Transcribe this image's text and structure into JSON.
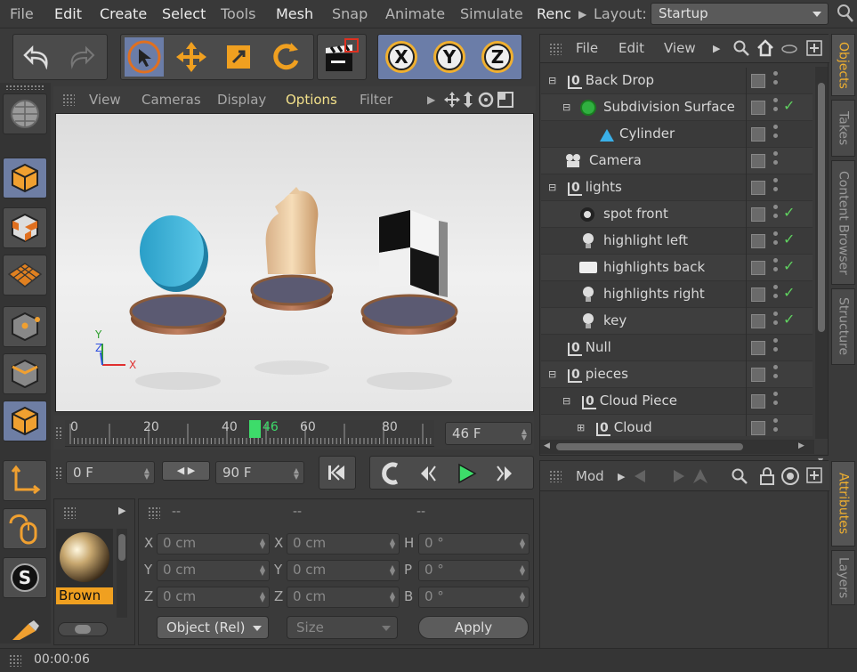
{
  "menu": {
    "items": [
      "File",
      "Edit",
      "Create",
      "Select",
      "Tools",
      "Mesh",
      "Snap",
      "Animate",
      "Simulate",
      "Renc"
    ],
    "layout_label": "Layout:",
    "layout_value": "Startup"
  },
  "viewport": {
    "menu": [
      "View",
      "Cameras",
      "Display",
      "Options",
      "Filter"
    ],
    "axis_labels": {
      "y": "Y",
      "z": "Z",
      "x": "X"
    }
  },
  "timeline": {
    "ticks": [
      "0",
      "20",
      "40",
      "46",
      "60",
      "80"
    ],
    "current_frame": "46 F"
  },
  "playback": {
    "start_frame": "0 F",
    "end_frame": "90 F"
  },
  "objects_panel": {
    "menu": [
      "File",
      "Edit",
      "View"
    ],
    "rows": [
      {
        "name": "Back Drop",
        "icon": "null-icon"
      },
      {
        "name": "Subdivision Surface",
        "icon": "subdivision-icon"
      },
      {
        "name": "Cylinder",
        "icon": "cylinder-icon"
      },
      {
        "name": "Camera",
        "icon": "camera-icon"
      },
      {
        "name": "lights",
        "icon": "null-icon"
      },
      {
        "name": "spot front",
        "icon": "spotlight-icon"
      },
      {
        "name": "highlight left",
        "icon": "light-icon"
      },
      {
        "name": "highlights back",
        "icon": "area-light-icon"
      },
      {
        "name": "highlights right",
        "icon": "light-icon"
      },
      {
        "name": "key",
        "icon": "light-icon"
      },
      {
        "name": "Null",
        "icon": "null-icon"
      },
      {
        "name": "pieces",
        "icon": "null-icon"
      },
      {
        "name": "Cloud Piece",
        "icon": "null-icon"
      },
      {
        "name": "Cloud",
        "icon": "null-icon"
      }
    ]
  },
  "side_tabs": {
    "top": [
      "Objects",
      "Takes",
      "Content Browser",
      "Structure"
    ],
    "bottom": [
      "Attributes",
      "Layers"
    ]
  },
  "attributes_panel": {
    "menu": "Mod"
  },
  "material": {
    "name": "Brown"
  },
  "coordinates": {
    "header": [
      "--",
      "--",
      "--"
    ],
    "labels_pos": [
      "X",
      "Y",
      "Z"
    ],
    "labels_size": [
      "X",
      "Y",
      "Z"
    ],
    "labels_rot": [
      "H",
      "P",
      "B"
    ],
    "pos_values": [
      "0 cm",
      "0 cm",
      "0 cm"
    ],
    "size_values": [
      "0 cm",
      "0 cm",
      "0 cm"
    ],
    "rot_values": [
      "0 °",
      "0 °",
      "0 °"
    ],
    "mode": "Object (Rel)",
    "size_mode": "Size",
    "apply": "Apply"
  },
  "status": {
    "time": "00:00:06"
  },
  "colors": {
    "accent_blue": "#6b7da8",
    "tab_active": "#f0b030",
    "play_green": "#3ddc6a",
    "frame_marker": "#3ddc6a"
  }
}
